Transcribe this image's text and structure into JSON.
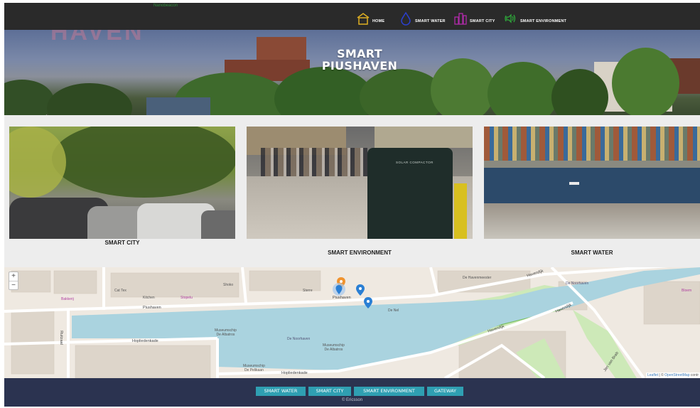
{
  "nav": {
    "tiny_link": "Nanobeacon",
    "items": [
      {
        "label": "HOME",
        "icon": "home-icon",
        "color": "#e0b022"
      },
      {
        "label": "SMART WATER",
        "icon": "water-drop-icon",
        "color": "#2a3fd0"
      },
      {
        "label": "SMART CITY",
        "icon": "city-icon",
        "color": "#b02aa8"
      },
      {
        "label": "SMART ENVIRONMENT",
        "icon": "sound-icon",
        "color": "#2ea83a"
      }
    ]
  },
  "hero": {
    "ghost_text": "HAVEN",
    "title_line1": "SMART",
    "title_line2": "PIUSHAVEN"
  },
  "cards": [
    {
      "label": "SMART CITY",
      "image": "parked-cars-trees-image"
    },
    {
      "label": "SMART ENVIRONMENT",
      "image": "street-solar-compactor-image",
      "sign": "SOLAR COMPACTOR"
    },
    {
      "label": "SMART WATER",
      "image": "harbor-containers-image"
    }
  ],
  "map": {
    "zoom_in": "+",
    "zoom_out": "−",
    "streets": {
      "piushaven_top": "Piushaven",
      "piushaven_mid": "Piushaven",
      "hopliedenkade": "Hopliedenkade",
      "hopliedenkade_bottom": "Hopliedenkade",
      "havendijk": "Havendijk",
      "havendijk_lower": "Havendijk",
      "havendijk_right": "Havendijk",
      "ruitzaal": "Ruitzaal",
      "jan_van_brab": "Jan van Brab",
      "de_havenmeester": "De Havenmeester",
      "de_noorhaven": "De Noorhaven",
      "museumschip_1": "Museumschip",
      "museumschip_1b": "De Albatros",
      "museumschip_2": "Museumschip",
      "museumschip_2b": "De Albatros",
      "museumschip_3": "Museumschip",
      "museumschip_3b": "De Pelikaan",
      "waterpark": "De Noorhaven",
      "sterre": "Sterre",
      "de_nel": "De Nel",
      "cat_tex": "Cat Tex",
      "kitchen": "Kitchen",
      "shoko": "Shoko",
      "stopelu": "Stopelu",
      "bloem": "Bloem",
      "bakkerij": "Bakkerij"
    },
    "attribution_leaflet": "Leaflet",
    "attribution_sep": " | © ",
    "attribution_osm": "OpenStreetMap",
    "attribution_rest": " contr"
  },
  "footer": {
    "buttons": [
      "SMART WATER",
      "SMART CITY",
      "SMART ENVIRONMENT",
      "GATEWAY"
    ],
    "copyright": "© Ericsson"
  }
}
